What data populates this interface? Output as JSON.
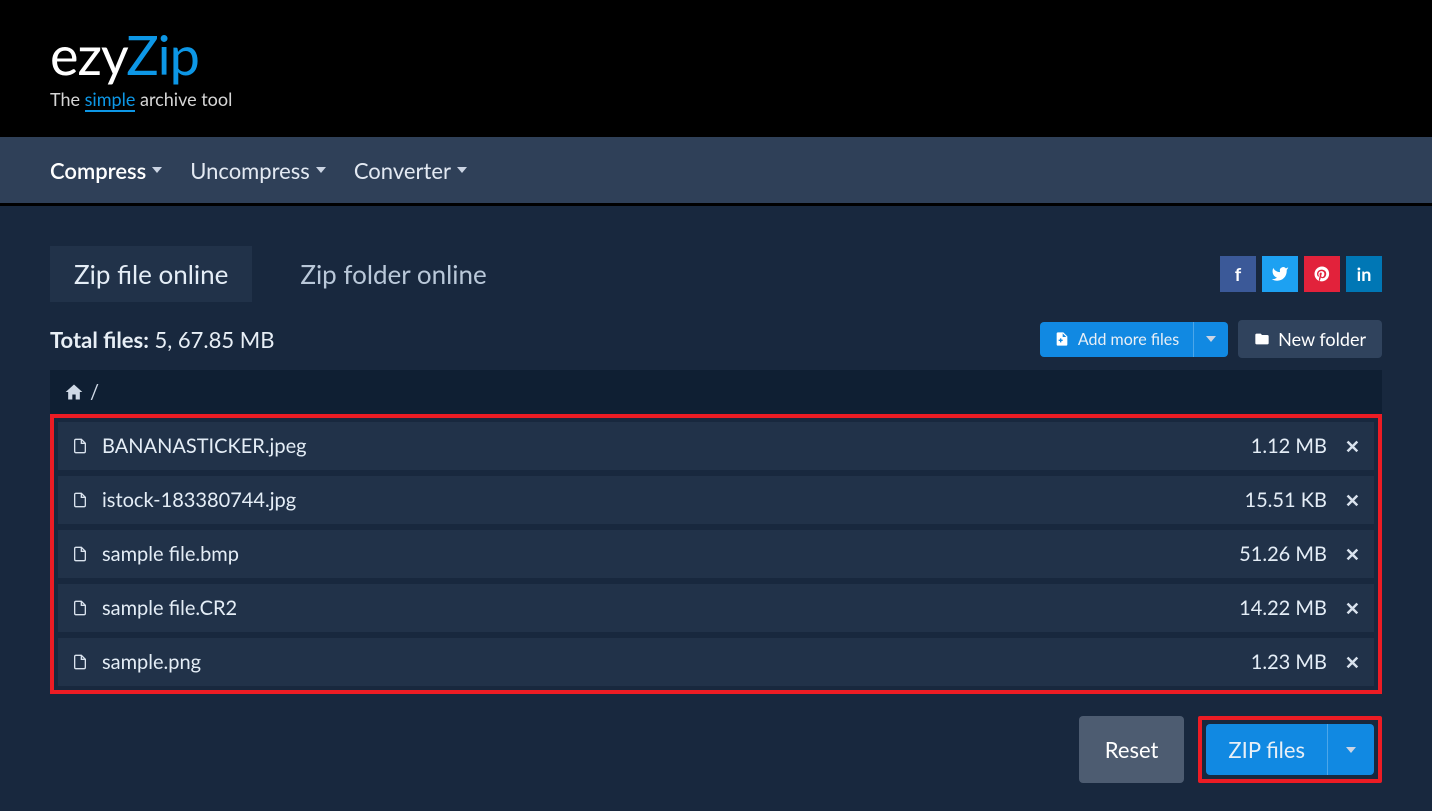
{
  "brand": {
    "part1": "ezy",
    "part2": "Zip",
    "tag_prefix": "The ",
    "tag_simple": "simple",
    "tag_suffix": " archive tool"
  },
  "nav": {
    "compress": "Compress",
    "uncompress": "Uncompress",
    "converter": "Converter"
  },
  "tabs": {
    "zip_file": "Zip file online",
    "zip_folder": "Zip folder online"
  },
  "toolbar": {
    "total_label": "Total files:",
    "total_value": " 5, 67.85 MB",
    "add_more": "Add more files",
    "new_folder": "New folder"
  },
  "breadcrumb": {
    "sep": "/"
  },
  "files": [
    {
      "name": "BANANASTICKER.jpeg",
      "size": "1.12 MB"
    },
    {
      "name": "istock-183380744.jpg",
      "size": "15.51 KB"
    },
    {
      "name": "sample file.bmp",
      "size": "51.26 MB"
    },
    {
      "name": "sample file.CR2",
      "size": "14.22 MB"
    },
    {
      "name": "sample.png",
      "size": "1.23 MB"
    }
  ],
  "actions": {
    "reset": "Reset",
    "zip": "ZIP files"
  }
}
